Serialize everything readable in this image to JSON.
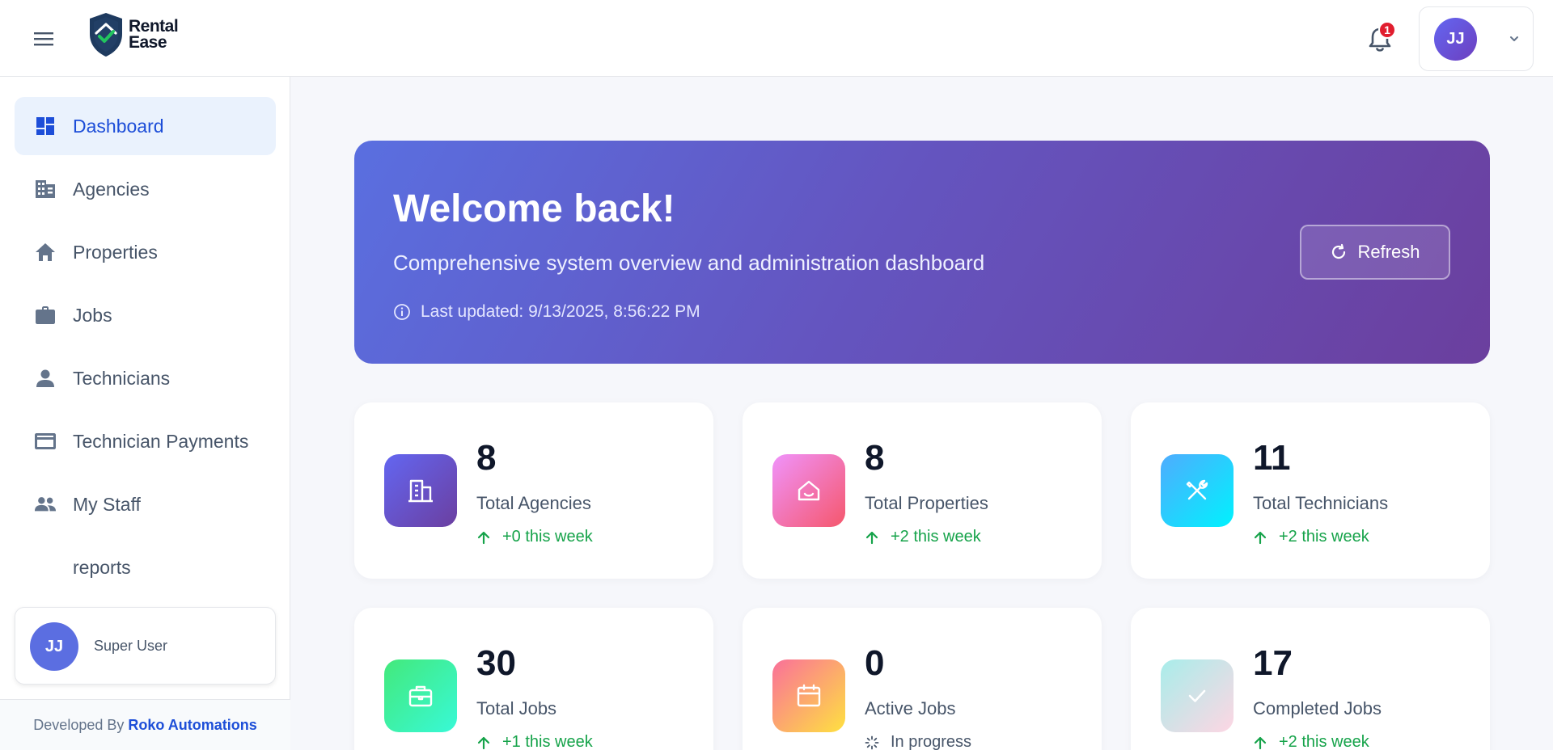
{
  "brand": {
    "line1": "Rental",
    "line2": "Ease"
  },
  "header": {
    "notification_count": "1",
    "user_initials": "JJ"
  },
  "sidebar": {
    "items": [
      {
        "label": "Dashboard",
        "icon": "dashboard-icon",
        "active": true
      },
      {
        "label": "Agencies",
        "icon": "building-icon"
      },
      {
        "label": "Properties",
        "icon": "home-icon"
      },
      {
        "label": "Jobs",
        "icon": "briefcase-icon"
      },
      {
        "label": "Technicians",
        "icon": "person-icon"
      },
      {
        "label": "Technician Payments",
        "icon": "credit-card-icon"
      },
      {
        "label": "My Staff",
        "icon": "group-icon"
      },
      {
        "label": "reports"
      }
    ],
    "profile": {
      "initials": "JJ",
      "name": "Super User"
    },
    "footer": {
      "prefix": "Developed By",
      "company": "Roko Automations"
    }
  },
  "banner": {
    "title": "Welcome back!",
    "subtitle": "Comprehensive system overview and administration dashboard",
    "last_updated": "Last updated: 9/13/2025, 8:56:22 PM",
    "refresh_label": "Refresh"
  },
  "stats": [
    {
      "value": "8",
      "label": "Total Agencies",
      "trend": "+0 this week",
      "icon": "building-icon",
      "colors": [
        "#6366f1",
        "#6b3fa0"
      ]
    },
    {
      "value": "8",
      "label": "Total Properties",
      "trend": "+2 this week",
      "icon": "home-icon",
      "colors": [
        "#f093fb",
        "#f5576c"
      ]
    },
    {
      "value": "11",
      "label": "Total Technicians",
      "trend": "+2 this week",
      "icon": "tools-icon",
      "colors": [
        "#4facfe",
        "#00f2fe"
      ]
    },
    {
      "value": "30",
      "label": "Total Jobs",
      "trend": "+1 this week",
      "icon": "briefcase-icon",
      "colors": [
        "#43e97b",
        "#38f9d7"
      ]
    },
    {
      "value": "0",
      "label": "Active Jobs",
      "trend": "In progress",
      "icon": "calendar-icon",
      "colors": [
        "#fa709a",
        "#fee140"
      ]
    },
    {
      "value": "17",
      "label": "Completed Jobs",
      "trend": "+2 this week",
      "icon": "check-icon",
      "colors": [
        "#a8edea",
        "#fed6e3"
      ]
    }
  ]
}
